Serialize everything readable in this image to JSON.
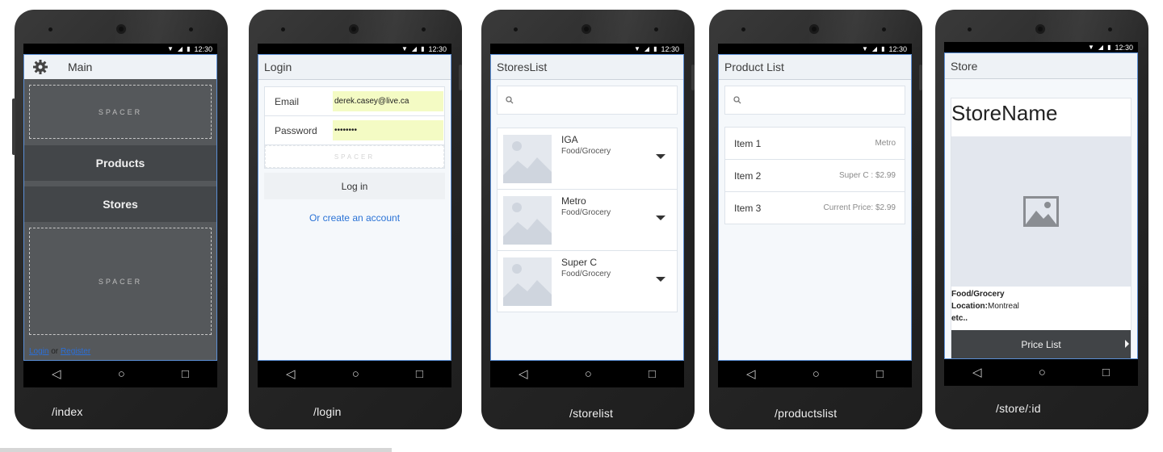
{
  "status_time": "12:30",
  "phones": {
    "index": {
      "route": "/index",
      "header_title": "Main",
      "spacer_top": "SPACER",
      "btn_products": "Products",
      "btn_stores": "Stores",
      "spacer_bottom": "SPACER",
      "login_link": "Login",
      "or_text": "or",
      "register_link": "Register"
    },
    "login": {
      "route": "/login",
      "header_title": "Login",
      "email_label": "Email",
      "email_value": "derek.casey@live.ca",
      "password_label": "Password",
      "password_value": "••••••••",
      "spacer": "SPACER",
      "login_button": "Log in",
      "create_link": "Or create an account"
    },
    "storelist": {
      "route": "/storelist",
      "header_title": "StoresList",
      "stores": [
        {
          "name": "IGA",
          "category": "Food/Grocery"
        },
        {
          "name": "Metro",
          "category": "Food/Grocery"
        },
        {
          "name": "Super C",
          "category": "Food/Grocery"
        }
      ]
    },
    "productslist": {
      "route": "/productslist",
      "header_title": "Product List",
      "items": [
        {
          "name": "Item 1",
          "price": "Metro"
        },
        {
          "name": "Item 2",
          "price": "Super C : $2.99"
        },
        {
          "name": "Item 3",
          "price": "Current Price: $2.99"
        }
      ]
    },
    "store": {
      "route": "/store/:id",
      "header_title": "Store",
      "store_name": "StoreName",
      "category": "Food/Grocery",
      "location_label": "Location:",
      "location_value": "Montreal",
      "etc": "etc..",
      "price_list_button": "Price List"
    }
  },
  "icons": {
    "settings": "gear-icon",
    "search": "search-icon",
    "dropdown": "caret-down-icon",
    "image_placeholder": "image-icon",
    "nav_back": "back-icon",
    "nav_home": "home-icon",
    "nav_recent": "recent-apps-icon"
  },
  "colors": {
    "accent_link": "#2b6fd8",
    "button_dark": "#434649",
    "input_autofill": "#f4fbc4",
    "frame_border": "#5b8fd6"
  }
}
